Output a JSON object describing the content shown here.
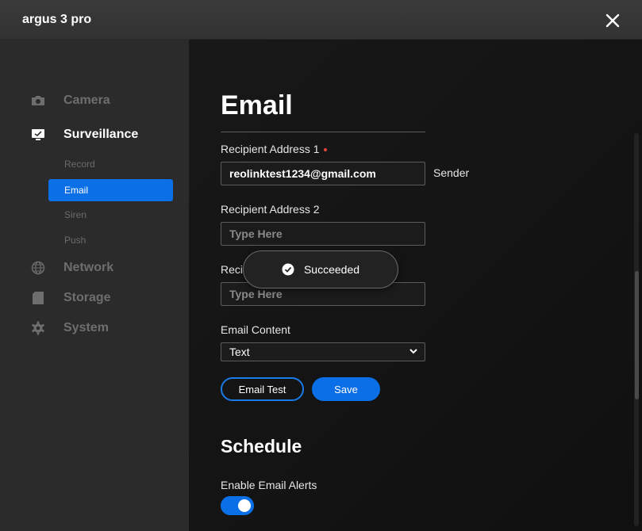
{
  "app": {
    "title": "argus 3 pro"
  },
  "sidebar": {
    "camera": "Camera",
    "surveillance": "Surveillance",
    "sub_items": [
      "Record",
      "Email",
      "Siren",
      "Push"
    ],
    "network": "Network",
    "storage": "Storage",
    "system": "System"
  },
  "email": {
    "title": "Email",
    "recipient1_label": "Recipient Address 1",
    "recipient1_value": "reolinktest1234@gmail.com",
    "sender_label": "Sender",
    "recipient2_label": "Recipient Address 2",
    "recipient2_placeholder": "Type Here",
    "recipient3_label": "Reci",
    "recipient3_placeholder": "Type Here",
    "content_label": "Email Content",
    "content_value": "Text",
    "test_button": "Email Test",
    "save_button": "Save"
  },
  "schedule": {
    "title": "Schedule",
    "enable_label": "Enable Email Alerts",
    "enabled": true
  },
  "toast": {
    "message": "Succeeded"
  },
  "colors": {
    "accent": "#0b6fe8",
    "required": "#e0453a"
  }
}
